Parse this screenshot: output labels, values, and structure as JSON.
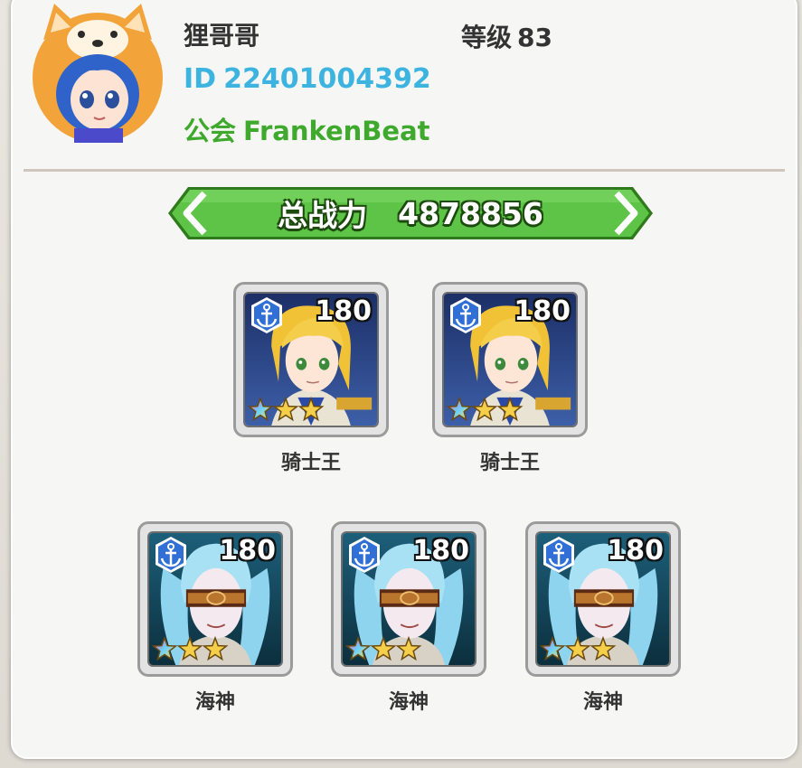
{
  "player": {
    "name": "狸哥哥",
    "level_label": "等级",
    "level": "83",
    "id_label": "ID",
    "id": "22401004392",
    "guild_label": "公会",
    "guild": "FrankenBeat"
  },
  "power": {
    "label": "总战力",
    "value": "4878856"
  },
  "heroes": [
    {
      "name": "骑士王",
      "level": "180",
      "type": "knight"
    },
    {
      "name": "骑士王",
      "level": "180",
      "type": "knight"
    },
    {
      "name": "海神",
      "level": "180",
      "type": "sea"
    },
    {
      "name": "海神",
      "level": "180",
      "type": "sea"
    },
    {
      "name": "海神",
      "level": "180",
      "type": "sea"
    }
  ],
  "colors": {
    "id": "#3db3e0",
    "guild": "#3ea92c",
    "banner": "#5ec447",
    "anchor_badge": "#2f6fd6"
  },
  "icons": [
    "anchor-icon",
    "star-icon",
    "chevron-left-icon",
    "chevron-right-icon"
  ]
}
